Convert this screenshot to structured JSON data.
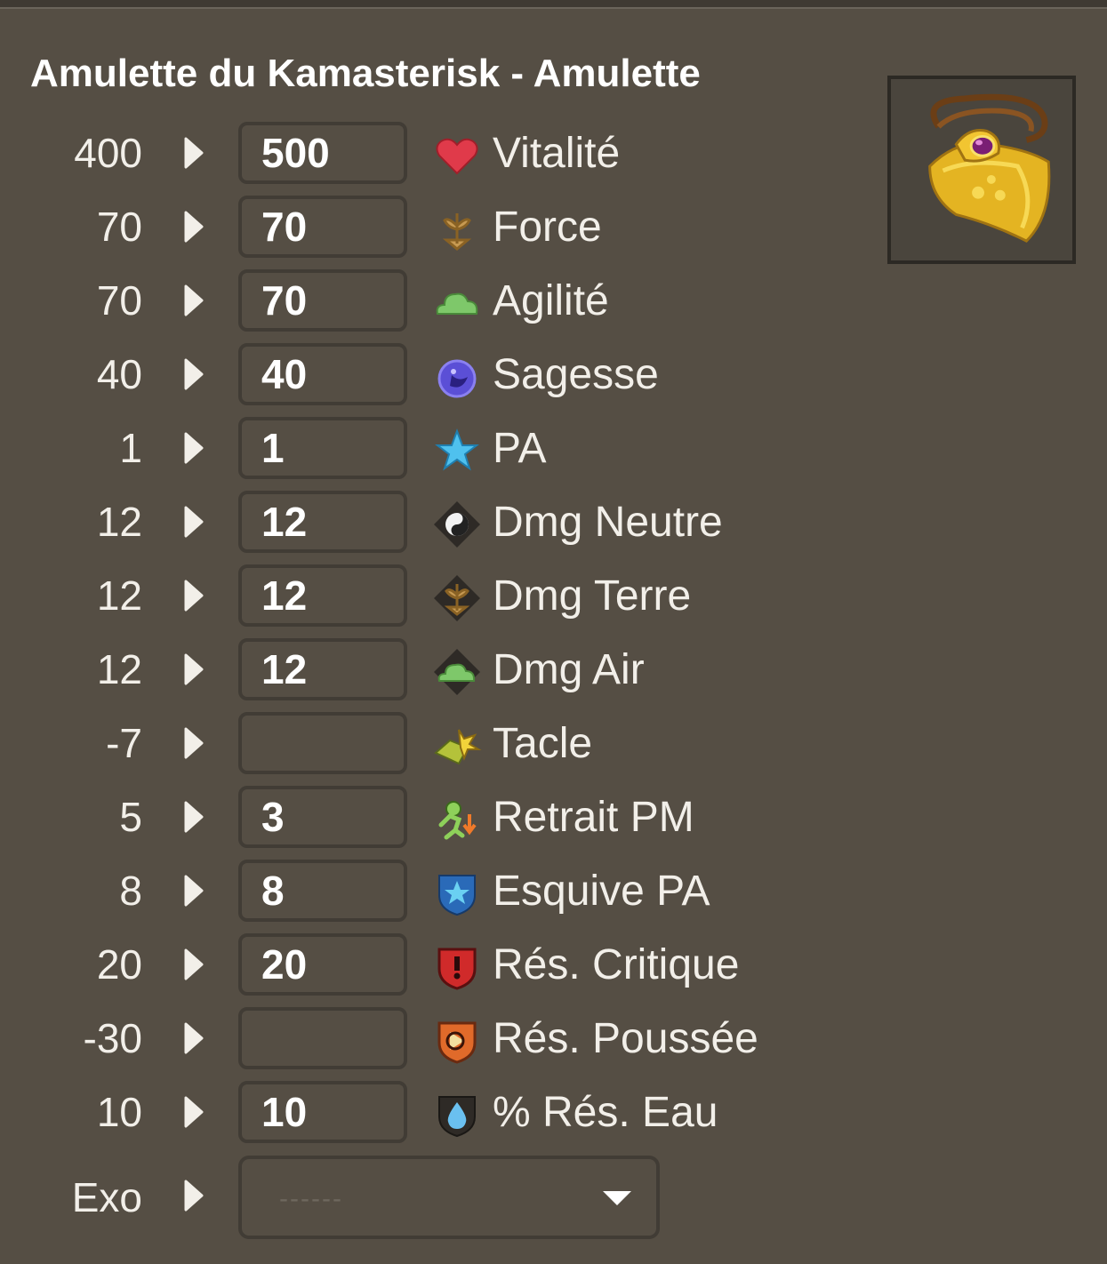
{
  "item": {
    "title": "Amulette du Kamasterisk - Amulette",
    "image_icon": "amulet-icon"
  },
  "stats": [
    {
      "base": "400",
      "value": "500",
      "label": "Vitalité",
      "icon": "heart-icon"
    },
    {
      "base": "70",
      "value": "70",
      "label": "Force",
      "icon": "earth-sprout-icon"
    },
    {
      "base": "70",
      "value": "70",
      "label": "Agilité",
      "icon": "air-cloud-icon"
    },
    {
      "base": "40",
      "value": "40",
      "label": "Sagesse",
      "icon": "moon-icon"
    },
    {
      "base": "1",
      "value": "1",
      "label": "PA",
      "icon": "star-icon"
    },
    {
      "base": "12",
      "value": "12",
      "label": "Dmg Neutre",
      "icon": "neutral-yinyang-icon"
    },
    {
      "base": "12",
      "value": "12",
      "label": "Dmg Terre",
      "icon": "earth-damage-icon"
    },
    {
      "base": "12",
      "value": "12",
      "label": "Dmg Air",
      "icon": "air-damage-icon"
    },
    {
      "base": "-7",
      "value": "",
      "label": "Tacle",
      "icon": "tackle-icon"
    },
    {
      "base": "5",
      "value": "3",
      "label": "Retrait PM",
      "icon": "mp-reduction-icon"
    },
    {
      "base": "8",
      "value": "8",
      "label": "Esquive PA",
      "icon": "ap-dodge-shield-icon"
    },
    {
      "base": "20",
      "value": "20",
      "label": "Rés. Critique",
      "icon": "critical-resistance-icon"
    },
    {
      "base": "-30",
      "value": "",
      "label": "Rés. Poussée",
      "icon": "pushback-resistance-icon"
    },
    {
      "base": "10",
      "value": "10",
      "label": "% Rés. Eau",
      "icon": "water-resistance-icon"
    }
  ],
  "exo": {
    "label": "Exo",
    "selected": "------"
  },
  "colors": {
    "background": "#554e44",
    "border": "#413c35",
    "text": "#f2efe9"
  }
}
